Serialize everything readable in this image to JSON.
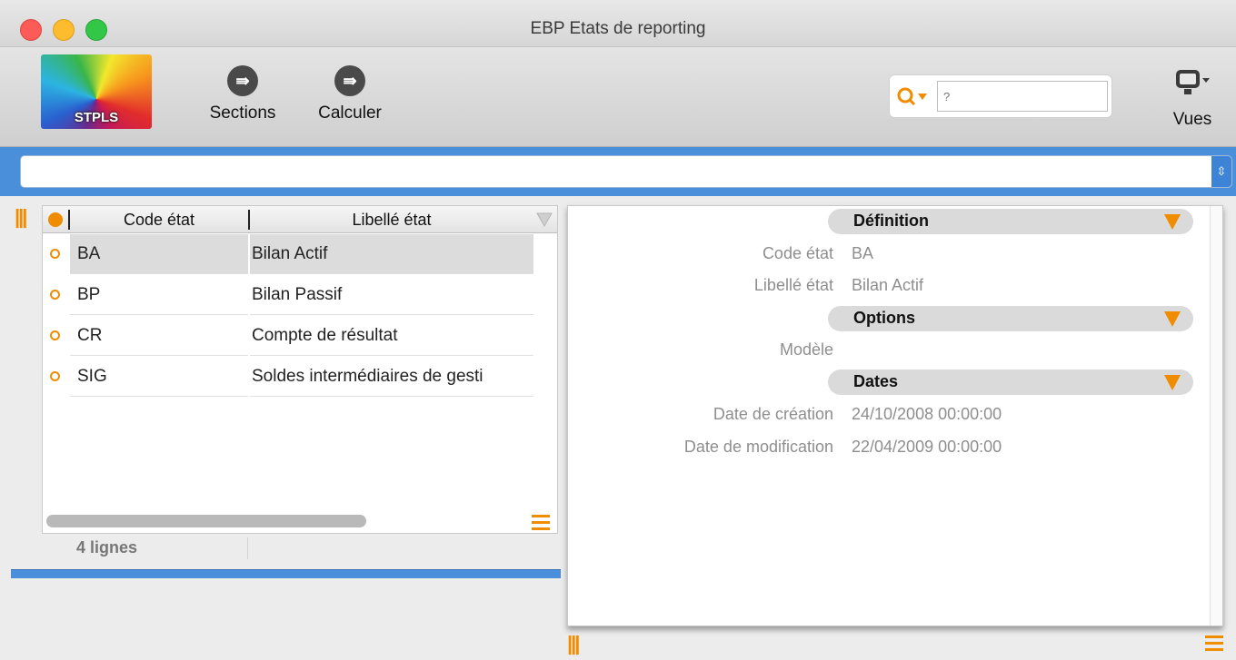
{
  "window": {
    "title": "EBP Etats de reporting"
  },
  "toolbar": {
    "logo_label": "STPLS",
    "sections_label": "Sections",
    "calculer_label": "Calculer",
    "search_placeholder": "?",
    "vues_label": "Vues"
  },
  "list": {
    "columns": [
      "Code état",
      "Libellé état"
    ],
    "rows": [
      {
        "code": "BA",
        "libelle": "Bilan Actif",
        "selected": true
      },
      {
        "code": "BP",
        "libelle": "Bilan Passif"
      },
      {
        "code": "CR",
        "libelle": "Compte de résultat"
      },
      {
        "code": "SIG",
        "libelle": "Soldes intermédiaires de gesti"
      }
    ],
    "count_label": "4 lignes"
  },
  "detail": {
    "sections": {
      "definition": "Définition",
      "options": "Options",
      "dates": "Dates"
    },
    "fields": {
      "code_label": "Code état",
      "code_value": "BA",
      "libelle_label": "Libellé état",
      "libelle_value": "Bilan Actif",
      "modele_label": "Modèle",
      "date_creation_label": "Date de création",
      "date_creation_value": "24/10/2008 00:00:00",
      "date_modification_label": "Date de modification",
      "date_modification_value": "22/04/2009 00:00:00"
    }
  },
  "colors": {
    "accent": "#f08c00",
    "strip": "#4a8fd9"
  },
  "icons": [
    "close-icon",
    "minimize-icon",
    "maximize-icon",
    "sections-icon",
    "calculer-icon",
    "search-icon",
    "vues-monitor-icon",
    "chevron-updown-icon",
    "filter-icon",
    "menu-icon",
    "resize-handle-icon"
  ]
}
